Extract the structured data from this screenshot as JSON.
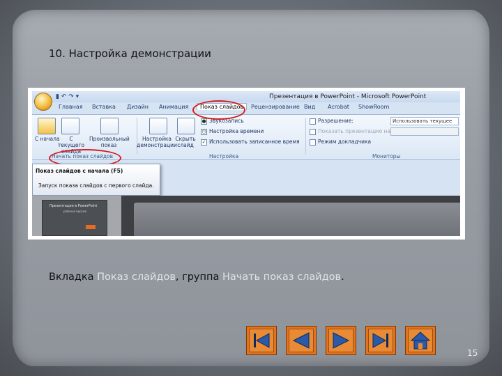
{
  "slide": {
    "title": "10. Настройка демонстрации",
    "caption_parts": [
      "Вкладка ",
      "Показ слайдов",
      ", группа ",
      "Начать показ слайдов",
      "."
    ],
    "page_number": "15",
    "accent_color": "#e2731f",
    "highlight_color": "#d61c1c"
  },
  "screenshot": {
    "window_title": "Презентация в PowerPoint - Microsoft PowerPoint",
    "tabs": [
      "Главная",
      "Вставка",
      "Дизайн",
      "Анимация",
      "Показ слайдов",
      "Рецензирование",
      "Вид",
      "Acrobat",
      "ShowRoom"
    ],
    "ribbon": {
      "start_group": {
        "from_start_label": "С начала",
        "from_current_label": "С текущего слайда",
        "custom_show_label": "Произвольный показ",
        "group_label": "Начать показ слайдов"
      },
      "setup_group": {
        "setup_label": "Настройка демонстрации",
        "hide_label": "Скрыть слайд",
        "record_narration": "Звукозапись",
        "rehearse_timings": "Настройка времени",
        "use_timings": "Использовать записанное время",
        "group_label": "Настройка"
      },
      "monitors_group": {
        "resolution_label": "Разрешение:",
        "resolution_value": "Использовать текущее",
        "show_on_label": "Показать презентацию на:",
        "presenter_view": "Режим докладчика",
        "group_label": "Мониторы"
      }
    },
    "tooltip": {
      "heading": "Показ слайдов с начала (F5)",
      "body": "Запуск показа слайдов с первого слайда."
    },
    "thumbnail": {
      "title": "Презентация в PowerPoint",
      "subtitle": "рабочая версия"
    }
  },
  "navigation": {
    "first_label": "first-slide",
    "prev_label": "previous-slide",
    "next_label": "next-slide",
    "last_label": "last-slide",
    "home_label": "home"
  }
}
